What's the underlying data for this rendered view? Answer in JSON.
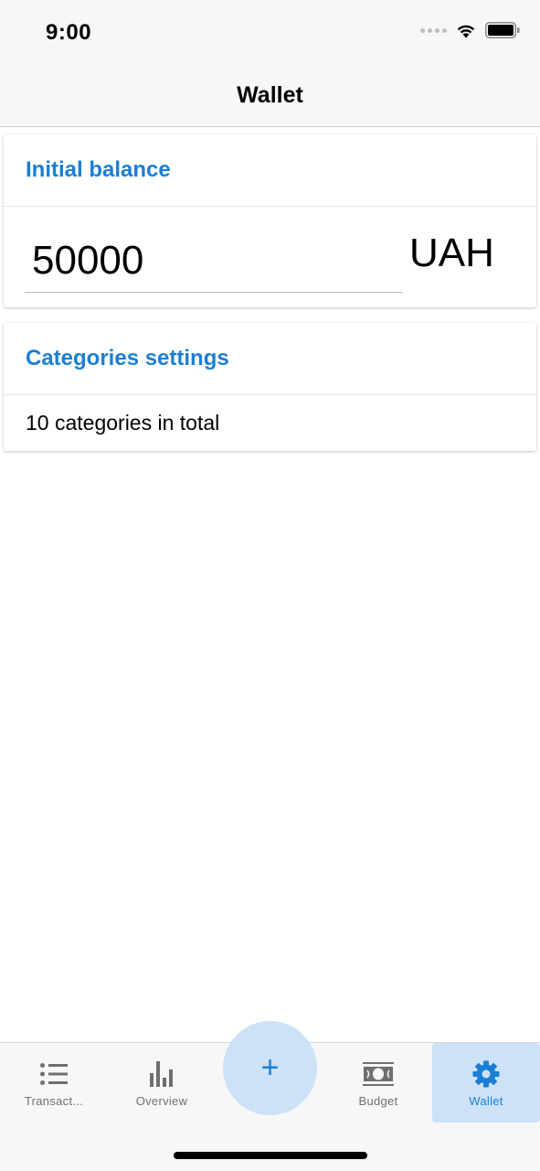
{
  "status_bar": {
    "time": "9:00"
  },
  "header": {
    "title": "Wallet"
  },
  "balance_card": {
    "title": "Initial balance",
    "value": "50000",
    "currency": "UAH"
  },
  "categories_card": {
    "title": "Categories settings",
    "summary": "10 categories in total"
  },
  "tab_bar": {
    "items": [
      {
        "label": "Transact...",
        "icon": "list-icon",
        "active": false
      },
      {
        "label": "Overview",
        "icon": "bar-chart-icon",
        "active": false
      },
      {
        "label": "Budget",
        "icon": "banknote-icon",
        "active": false
      },
      {
        "label": "Wallet",
        "icon": "gear-icon",
        "active": true
      }
    ],
    "add_button": {
      "label": "+",
      "icon": "plus-icon"
    }
  },
  "colors": {
    "accent": "#1a7fd4",
    "active_tab_bg": "#cde2f7",
    "bar_bg": "#f7f7f7",
    "inactive": "#6f6f6f"
  }
}
